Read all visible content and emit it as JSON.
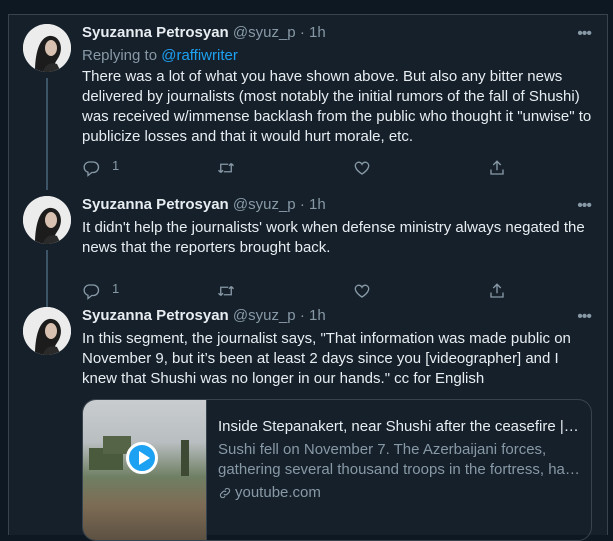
{
  "tweets": [
    {
      "name": "Syuzanna Petrosyan",
      "handle": "@syuz_p",
      "dot": "·",
      "time": "1h",
      "more_icon": "more-horizontal-icon",
      "reply_prefix": "Replying to ",
      "reply_mention": "@raffiwriter",
      "lines": [
        "There was a lot of what you have shown above. But also any bitter news",
        "delivered by journalists (most notably the initial rumors of the fall of Shushi)",
        "was received w/immense backlash from the public who thought it \"unwise\" to",
        "publicize losses and that it would hurt morale, etc."
      ],
      "reply_count": "1"
    },
    {
      "name": "Syuzanna Petrosyan",
      "handle": "@syuz_p",
      "dot": "·",
      "time": "1h",
      "lines": [
        "It didn't help the journalists' work when defense ministry always negated the",
        "news that the reporters brought back."
      ],
      "reply_count": "1"
    },
    {
      "name": "Syuzanna Petrosyan",
      "handle": "@syuz_p",
      "dot": "·",
      "time": "1h",
      "lines": [
        "In this segment, the journalist says, \"That information was made public on",
        "November 9, but it’s been at least 2 days since you [videographer] and I",
        "knew that Shushi was no longer in our hands.\" cc for English"
      ],
      "card": {
        "title": "Inside Stepanakert, near Shushi after the ceasefire | Civilnet",
        "desc_lines": [
          "Sushi fell on November 7. The Azerbaijani forces,",
          "gathering several thousand troops in the fortress, had surrounded"
        ],
        "domain": "youtube.com"
      }
    }
  ],
  "colors": {
    "background": "#15202b",
    "text": "#e8edf1",
    "muted": "#8899a6",
    "accent": "#1da1f2",
    "border": "#38444d"
  },
  "icons": [
    "reply-icon",
    "retweet-icon",
    "like-icon",
    "share-icon",
    "link-icon",
    "play-icon"
  ]
}
